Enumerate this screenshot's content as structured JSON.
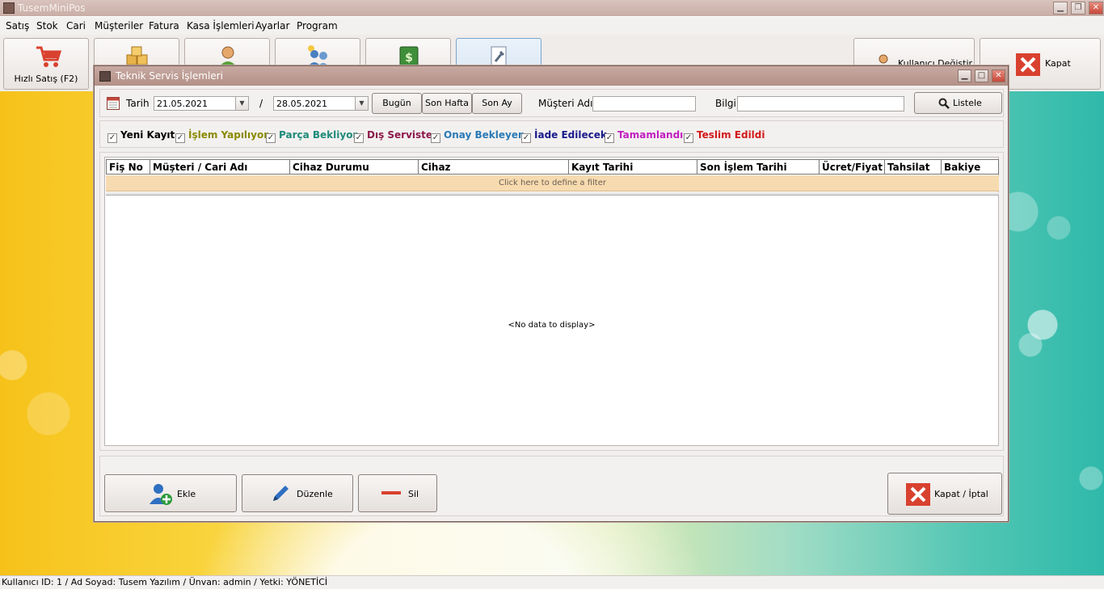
{
  "app": {
    "title": "TusemMiniPos",
    "icon": "app-grid-icon"
  },
  "menu": [
    "Satış",
    "Stok",
    "Cari",
    "Müşteriler",
    "Fatura",
    "Kasa İşlemleri",
    "Ayarlar",
    "Program"
  ],
  "toolbar": {
    "quick_sale_label": "Hızlı Satış (F2)",
    "user_change_label": "Kullanıcı Değiştir",
    "close_label": "Kapat"
  },
  "dialog": {
    "title": "Teknik Servis İşlemleri",
    "date_label": "Tarih",
    "date_from": "21.05.2021",
    "date_separator": "/",
    "date_to": "28.05.2021",
    "today_label": "Bugün",
    "last_week_label": "Son Hafta",
    "last_month_label": "Son Ay",
    "customer_label": "Müşteri Adı",
    "customer_value": "",
    "info_label": "Bilgi",
    "info_value": "",
    "list_label": "Listele",
    "status_filters": [
      {
        "label": "Yeni Kayıt",
        "color": "#000000"
      },
      {
        "label": "İşlem Yapılıyor",
        "color": "#8a8a00"
      },
      {
        "label": "Parça Bekliyor",
        "color": "#1e8a7a"
      },
      {
        "label": "Dış Serviste",
        "color": "#8b1a4a"
      },
      {
        "label": "Onay Bekleyen",
        "color": "#2a7ab5"
      },
      {
        "label": "İade Edilecek",
        "color": "#1a1a8b"
      },
      {
        "label": "Tamamlandı",
        "color": "#c01ec0"
      },
      {
        "label": "Teslim Edildi",
        "color": "#d21a1a"
      }
    ],
    "columns": [
      "Fiş No",
      "Müşteri / Cari Adı",
      "Cihaz Durumu",
      "Cihaz",
      "Kayıt Tarihi",
      "Son İşlem Tarihi",
      "Ücret/Fiyat",
      "Tahsilat",
      "Bakiye"
    ],
    "filter_hint": "Click here to define a filter",
    "empty_text": "<No data to display>",
    "add_label": "Ekle",
    "edit_label": "Düzenle",
    "delete_label": "Sil",
    "close_cancel_label": "Kapat / İptal"
  },
  "status": {
    "text": "Kullanıcı ID: 1 / Ad Soyad: Tusem Yazılım / Ünvan: admin / Yetki: YÖNETİCİ"
  },
  "colors": {
    "accent_red": "#d9412f",
    "filter_row": "#f7dbb0"
  }
}
